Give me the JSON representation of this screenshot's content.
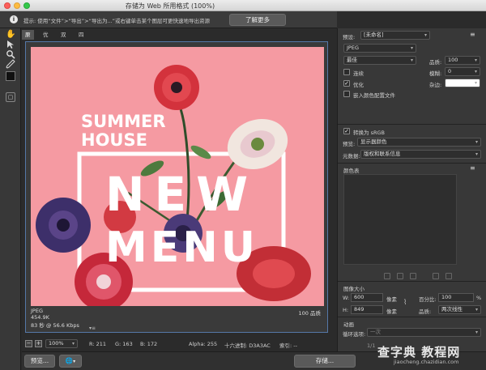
{
  "window": {
    "title": "存储为 Web 所用格式 (100%)"
  },
  "infobar": {
    "info_icon": "i",
    "text": "提示: 使用“文件”>“导出”>“导出为...”或右键单击某个图层可更快速地导出资源",
    "learn_more": "了解更多"
  },
  "tools": [
    "hand-icon",
    "slice-select-icon",
    "zoom-icon",
    "eyedropper-icon"
  ],
  "view_tabs": [
    "原稿",
    "优化",
    "双联",
    "四联"
  ],
  "artwork": {
    "line1": "SUMMER",
    "line2": "HOUSE",
    "big1": "NEW",
    "big2": "MENU",
    "bg_color": "#f59aa2"
  },
  "preview_info": {
    "format": "JPEG",
    "size": "454.9K",
    "time": "83 秒 @ 56.6 Kbps",
    "menu_glyph": "▾≡",
    "quality": "100 品质"
  },
  "status": {
    "zoom": "100%",
    "r": "R: 211",
    "g": "G: 163",
    "b": "B: 172",
    "alpha": "Alpha: 255",
    "hex": "十六进制: D3A3AC",
    "index": "索引: --"
  },
  "bottom": {
    "preview_btn": "预览...",
    "save_btn": "存储...",
    "page": "1/1"
  },
  "settings": {
    "preset_label": "预设:",
    "preset_value": "[未命名]",
    "format": "JPEG",
    "quality_preset": "最佳",
    "quality_label": "品质:",
    "quality_value": "100",
    "progressive": "连续",
    "blur_label": "模糊:",
    "blur_value": "0",
    "optimized": "优化",
    "matte_label": "杂边:",
    "embed_profile": "嵌入颜色配置文件",
    "convert_srgb": "转换为 sRGB",
    "preview_label": "预览:",
    "preview_value": "显示器颜色",
    "metadata_label": "元数据:",
    "metadata_value": "版权和联系信息",
    "color_table": "颜色表",
    "image_size": "图像大小",
    "w_label": "W:",
    "w_value": "600",
    "h_label": "H:",
    "h_value": "849",
    "px_unit": "像素",
    "percent_label": "百分比:",
    "percent_value": "100",
    "percent_unit": "%",
    "quality2_label": "品质:",
    "quality2_value": "两次线性",
    "animation": "动画",
    "loop_label": "循环选项:",
    "loop_value": "一次"
  },
  "watermark": {
    "main": "查字典 教程网",
    "sub": "jiaocheng.chazidian.com"
  }
}
